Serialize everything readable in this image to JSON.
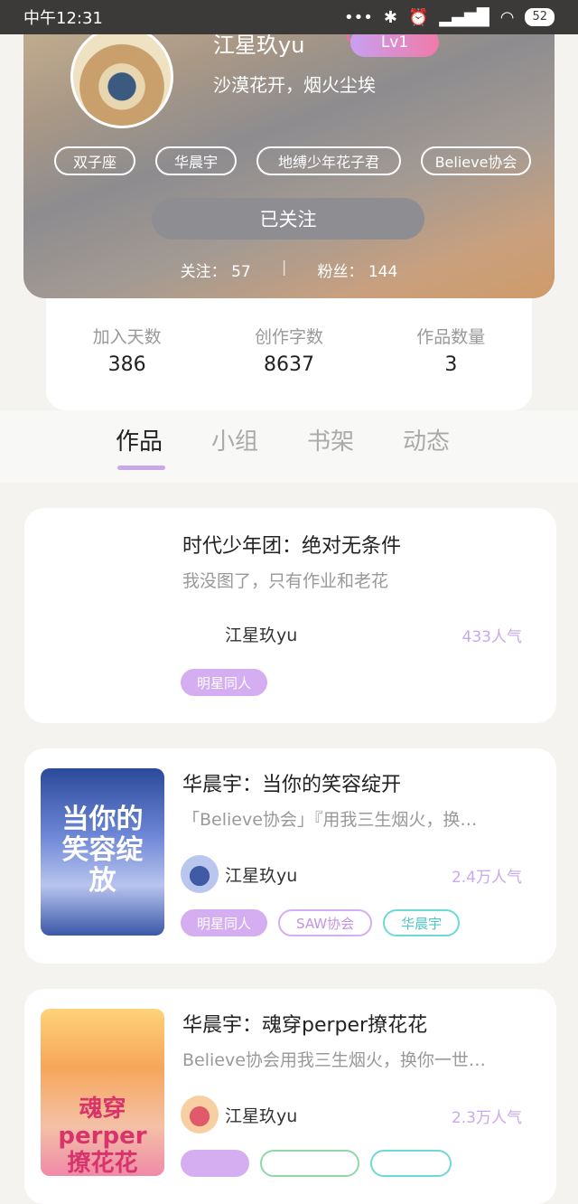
{
  "status_bar": {
    "time": "中午12:31",
    "battery": "52"
  },
  "profile": {
    "username": "江星玖yu",
    "level": "Lv1",
    "motto": "沙漠花开，烟火尘埃",
    "tags": [
      "双子座",
      "华晨宇",
      "地缚少年花子君",
      "Believe协会"
    ],
    "follow_button": "已关注",
    "following_label": "关注：",
    "following_count": "57",
    "fans_label": "粉丝：",
    "fans_count": "144",
    "separator": "|"
  },
  "stats": [
    {
      "label": "加入天数",
      "value": "386"
    },
    {
      "label": "创作字数",
      "value": "8637"
    },
    {
      "label": "作品数量",
      "value": "3"
    }
  ],
  "tabs": [
    {
      "label": "作品",
      "active": true
    },
    {
      "label": "小组",
      "active": false
    },
    {
      "label": "书架",
      "active": false
    },
    {
      "label": "动态",
      "active": false
    }
  ],
  "works": [
    {
      "title": "时代少年团：绝对无条件",
      "description": "我没图了，只有作业和老花",
      "author": "江星玖yu",
      "popularity": "433人气",
      "tags": [
        "明星同人"
      ]
    },
    {
      "title": "华晨宇：当你的笑容绽开",
      "description": "「Believe协会」『用我三生烟火，换…",
      "author": "江星玖yu",
      "popularity": "2.4万人气",
      "tags": [
        "明星同人",
        "SAW协会",
        "华晨宇"
      ],
      "cover_text": "当你的笑容绽放"
    },
    {
      "title": "华晨宇：魂穿perper撩花花",
      "description": "Believe协会用我三生烟火，换你一世…",
      "author": "江星玖yu",
      "popularity": "2.3万人气",
      "tags": [
        "",
        "",
        ""
      ],
      "cover_text": "魂穿perper撩花花"
    }
  ]
}
